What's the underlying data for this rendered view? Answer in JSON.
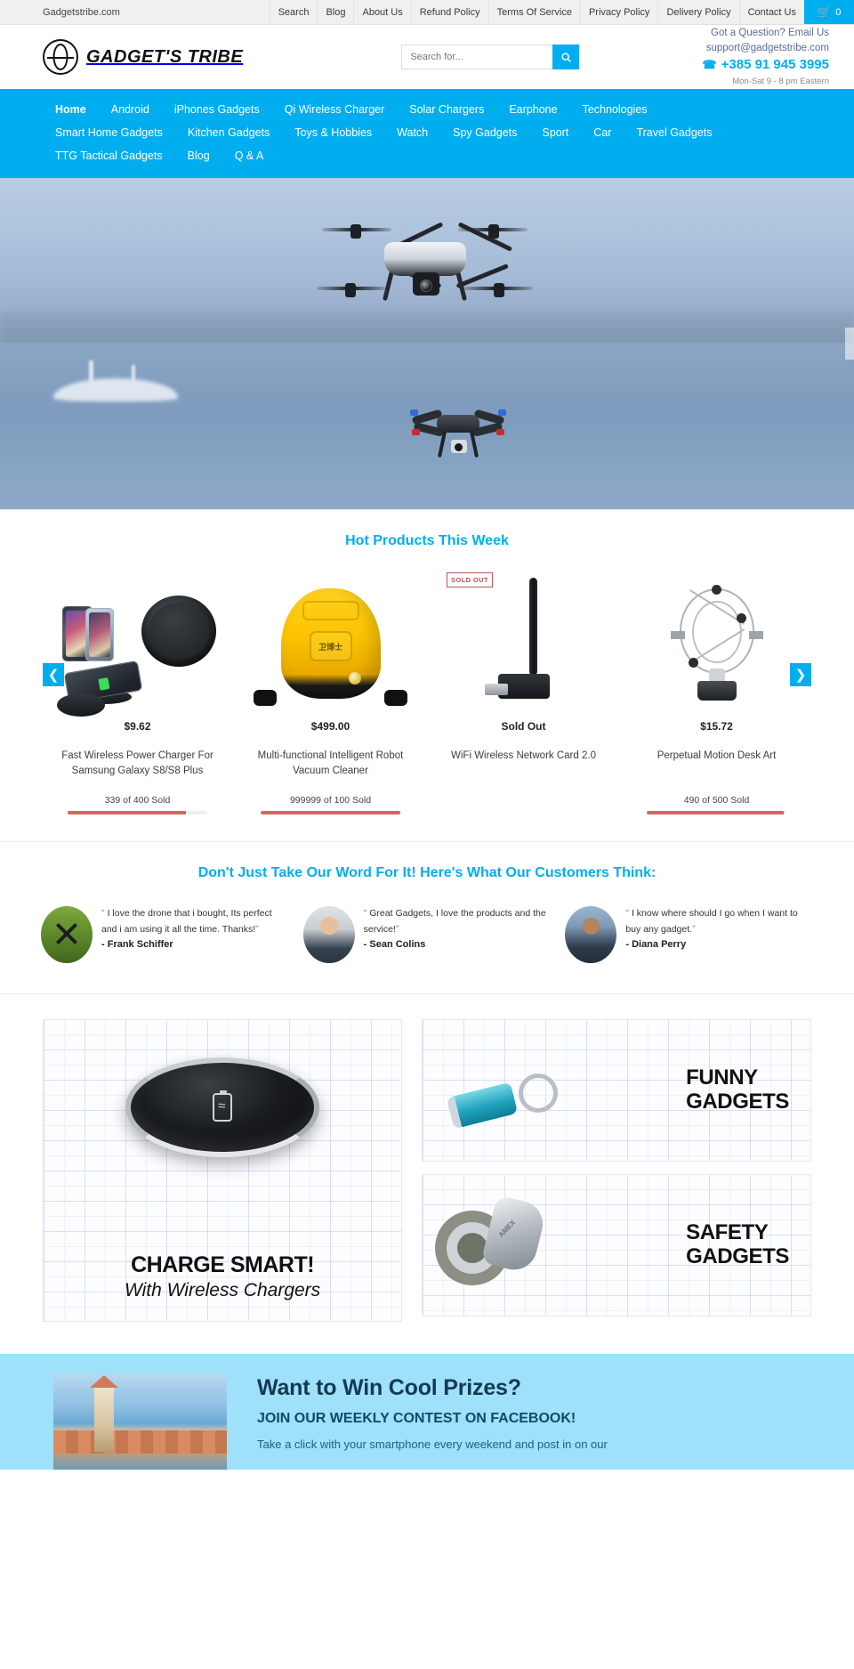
{
  "topbar": {
    "brand": "Gadgetstribe.com",
    "links": [
      "Search",
      "Blog",
      "About Us",
      "Refund Policy",
      "Terms Of Service",
      "Privacy Policy",
      "Delivery Policy",
      "Contact Us"
    ],
    "cart_icon": "cart-icon",
    "cart_count": "0"
  },
  "header": {
    "logo_text": "GADGET'S TRIBE",
    "logo_icon": "globe-logo-icon",
    "search_placeholder": "Search for...",
    "search_value": "",
    "search_icon": "search-icon",
    "question": "Got a Question? Email Us",
    "email": "support@gadgetstribe.com",
    "phone_icon": "phone-icon",
    "phone": "+385 91 945 3995",
    "hours": "Mon-Sat 9 - 8 pm Eastern"
  },
  "nav": {
    "row1": [
      "Home",
      "Android",
      "iPhones Gadgets",
      "Qi Wireless Charger",
      "Solar Chargers",
      "Earphone",
      "Technologies"
    ],
    "row2": [
      "Smart Home Gadgets",
      "Kitchen Gadgets",
      "Toys & Hobbies",
      "Watch",
      "Spy Gadgets",
      "Sport",
      "Car",
      "Travel Gadgets"
    ],
    "row3": [
      "TTG Tactical Gadgets",
      "Blog",
      "Q & A"
    ],
    "active": "Home"
  },
  "hero": {
    "alt": "drones-flying-over-harbor",
    "next_arrow_icon": "hero-next-arrow-icon"
  },
  "products_section": {
    "title": "Hot Products This Week",
    "prev_icon": "carousel-prev-icon",
    "next_icon": "carousel-next-icon",
    "items": [
      {
        "price": "$9.62",
        "title": "Fast Wireless Power Charger For Samsung Galaxy S8/S8 Plus",
        "sold_text": "339 of 400 Sold",
        "sold_pct": 85,
        "badge": "",
        "has_bar": true
      },
      {
        "price": "$499.00",
        "title": "Multi-functional Intelligent Robot Vacuum Cleaner",
        "sold_text": "999999 of 100 Sold",
        "sold_pct": 100,
        "badge": "",
        "has_bar": true
      },
      {
        "price": "Sold Out",
        "title": "WiFi Wireless Network Card 2.0",
        "sold_text": "",
        "sold_pct": 0,
        "badge": "SOLD OUT",
        "has_bar": false
      },
      {
        "price": "$15.72",
        "title": "Perpetual Motion Desk Art",
        "sold_text": "490 of 500 Sold",
        "sold_pct": 98,
        "badge": "",
        "has_bar": true
      }
    ]
  },
  "testimonials_section": {
    "title": "Don't Just Take Our Word For It! Here's What Our Customers Think:",
    "items": [
      {
        "avatar": "drone-avatar",
        "quote": "I love the drone that i bought, Its perfect and i am using it all the time. Thanks!",
        "name": "- Frank Schiffer"
      },
      {
        "avatar": "businessman-avatar",
        "quote": "Great Gadgets, I love the products and the service!",
        "name": "- Sean Colins"
      },
      {
        "avatar": "man-on-phone-avatar",
        "quote": "I know where should I go when I want to buy any gadget.",
        "name": "- Diana Perry"
      }
    ]
  },
  "banners": {
    "charge": {
      "title": "CHARGE SMART!",
      "subtitle": "With Wireless Chargers"
    },
    "funny": {
      "line1": "FUNNY",
      "line2": "GADGETS"
    },
    "safety": {
      "line1": "SAFETY",
      "line2": "GADGETS"
    }
  },
  "contest": {
    "image_alt": "dubrovnik-old-town",
    "heading": "Want to Win Cool Prizes?",
    "subheading": "JOIN OUR WEEKLY CONTEST ON FACEBOOK!",
    "body": "Take a click with your smartphone every weekend and post in on our"
  },
  "colors": {
    "accent": "#00AEEF",
    "contest_bg": "#9FE0FA",
    "sold_bar": "#d9635f"
  }
}
